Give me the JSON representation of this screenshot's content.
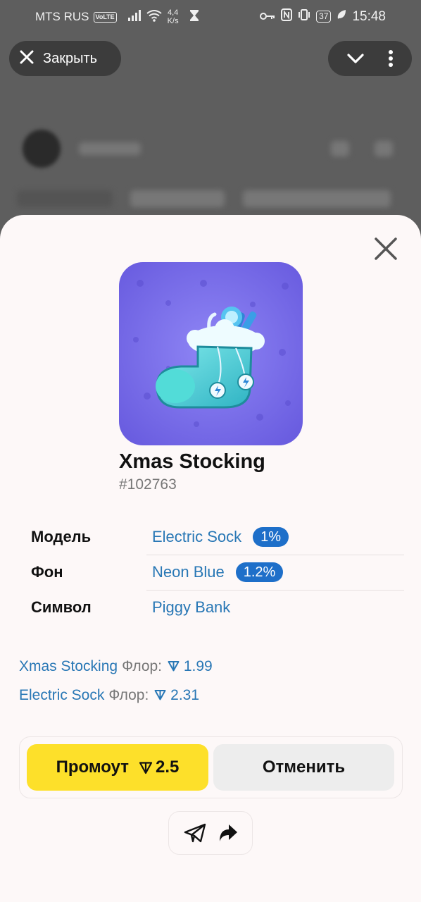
{
  "status_bar": {
    "carrier": "MTS RUS",
    "volte": "VoLTE",
    "net_speed_value": "4,4",
    "net_speed_unit": "K/s",
    "battery": "37",
    "time": "15:48"
  },
  "overlay": {
    "close_label": "Закрыть"
  },
  "gift": {
    "title": "Xmas Stocking",
    "number": "#102763",
    "attributes": [
      {
        "label": "Модель",
        "value": "Electric Sock",
        "badge": "1%"
      },
      {
        "label": "Фон",
        "value": "Neon Blue",
        "badge": "1.2%"
      },
      {
        "label": "Символ",
        "value": "Piggy Bank",
        "badge": ""
      }
    ]
  },
  "floors": [
    {
      "name": "Xmas Stocking",
      "label": "Флор:",
      "value": "1.99"
    },
    {
      "name": "Electric Sock",
      "label": "Флор:",
      "value": "2.31"
    }
  ],
  "actions": {
    "promote_label": "Промоут",
    "promote_price": "2.5",
    "cancel_label": "Отменить"
  },
  "colors": {
    "accent_link": "#2877b5",
    "badge": "#1e6fc9",
    "promote_button": "#fde02a",
    "gift_background": "#7a6ee8"
  }
}
